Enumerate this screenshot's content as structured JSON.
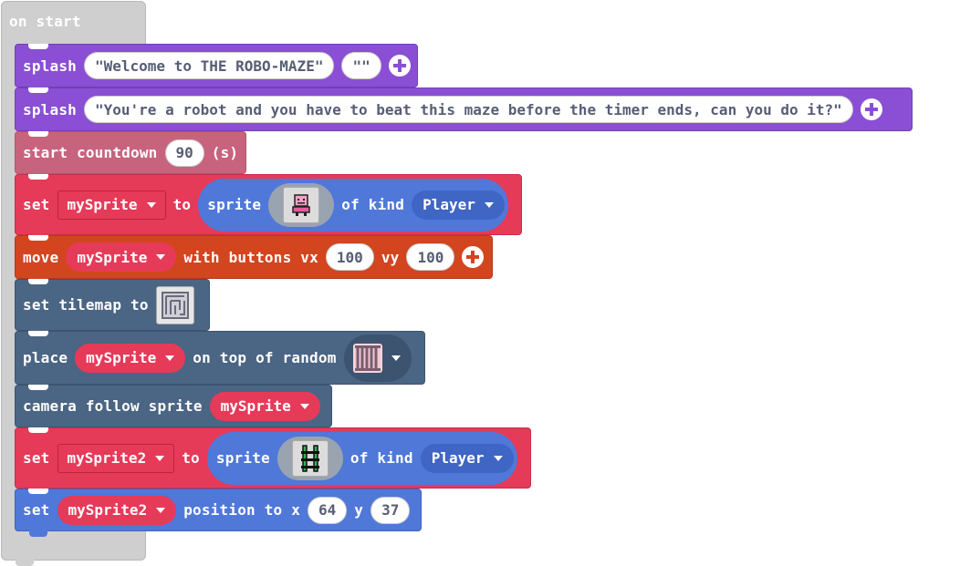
{
  "on_start": {
    "label": "on start"
  },
  "splash1": {
    "keyword": "splash",
    "title": "\"Welcome to THE ROBO-MAZE\"",
    "subtitle": "\"\""
  },
  "splash2": {
    "keyword": "splash",
    "title": "\"You're a robot and you have to beat this maze before the timer ends, can you do it?\""
  },
  "countdown": {
    "keyword": "start countdown",
    "value": "90",
    "unit": "(s)"
  },
  "set_sprite": {
    "set": "set",
    "variable": "mySprite",
    "to": "to",
    "sprite": "sprite",
    "image_icon": "robot-sprite-icon",
    "of_kind": "of kind",
    "kind": "Player"
  },
  "move": {
    "keyword": "move",
    "variable": "mySprite",
    "with_buttons": "with buttons vx",
    "vx": "100",
    "vy_label": "vy",
    "vy": "100"
  },
  "tilemap": {
    "keyword": "set tilemap to",
    "image_icon": "maze-tilemap-icon"
  },
  "place": {
    "keyword": "place",
    "variable": "mySprite",
    "on_top": "on top of random",
    "tile_icon": "gate-tile-icon"
  },
  "camera": {
    "keyword": "camera follow sprite",
    "variable": "mySprite"
  },
  "set_sprite2": {
    "set": "set",
    "variable": "mySprite2",
    "to": "to",
    "sprite": "sprite",
    "image_icon": "ladder-sprite-icon",
    "of_kind": "of kind",
    "kind": "Player"
  },
  "position": {
    "set": "set",
    "variable": "mySprite2",
    "position_to": "position to x",
    "x": "64",
    "y_label": "y",
    "y": "37"
  },
  "colors": {
    "events": "#cfcfcf",
    "scene": "#8a4fd4",
    "info": "#c8637e",
    "sprites": "#e63a59",
    "controller": "#d3451f",
    "scene_dark": "#4b6584",
    "sprite_blue": "#4f78d9"
  }
}
